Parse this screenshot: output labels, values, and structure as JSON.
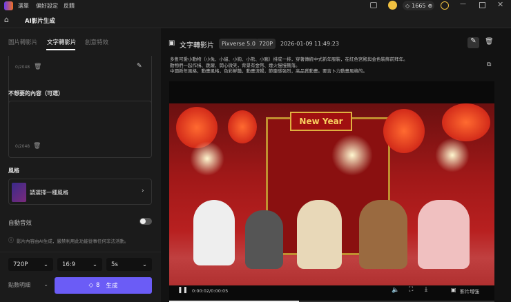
{
  "titlebar": {
    "menu": [
      "選單",
      "偏好設定",
      "反饋"
    ],
    "credits": "1665"
  },
  "header": {
    "title": "AI影片生成"
  },
  "tabs": [
    "圖片轉影片",
    "文字轉影片",
    "創意特效"
  ],
  "prompt": {
    "count": "0/2048"
  },
  "negative": {
    "label": "不想要的內容（可選）",
    "count": "0/2048"
  },
  "style": {
    "label": "風格",
    "placeholder": "請選擇一種風格"
  },
  "audio": {
    "label": "自動音效",
    "enabled": false
  },
  "notice": "影片內容由AI生成，嚴禁利用此功能從事任何非法活動。",
  "options": {
    "resolution": "720P",
    "ratio": "16:9",
    "duration": "5s"
  },
  "footer": {
    "credits_detail": "點數明細",
    "cost": "8",
    "generate": "生成"
  },
  "result": {
    "title": "文字轉影片",
    "model": "Pixverse 5.0",
    "resolution": "720P",
    "timestamp": "2026-01-09 11:49:23",
    "prompt_lines": [
      "多隻可愛小動物（小兔、小貓、小狗、小熊、小豬）排成一排，穿著傳統中式新年服裝，在紅色宮殿與金色裝飾前拜年。",
      "動物們一起作揖、跳躍、開心微笑，背景有金幣、煙火慢慢飄落。",
      "中國新年風格，動畫風格，色彩鮮豔，動畫流暢，節慶感強烈，高品質動畫。要吉卜力動畫風格的。"
    ]
  },
  "player": {
    "time": "0:00:02/0:00:05",
    "enhance": "影片增強",
    "progress": 0.4,
    "sign": "New Year"
  },
  "colors": {
    "accent": "#6b5cf6"
  }
}
